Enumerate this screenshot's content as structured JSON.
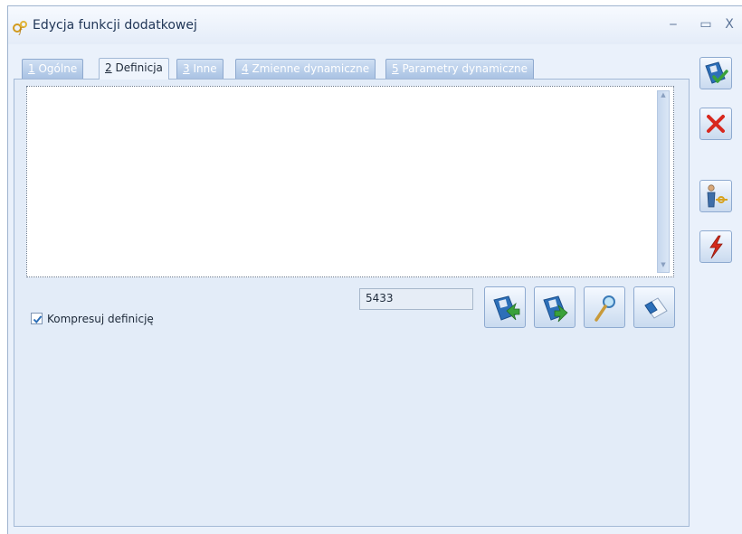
{
  "window": {
    "title": "Edycja funkcji dodatkowej",
    "minimize_glyph": "‒",
    "maximize_glyph": "▭",
    "close_glyph": "X"
  },
  "tabs": [
    {
      "num": "1",
      "label": "Ogólne",
      "active": false
    },
    {
      "num": "2",
      "label": "Definicja",
      "active": true
    },
    {
      "num": "3",
      "label": "Inne",
      "active": false
    },
    {
      "num": "4",
      "label": "Zmienne dynamiczne",
      "active": false
    },
    {
      "num": "5",
      "label": "Parametry dynamiczne",
      "active": false
    }
  ],
  "definition": {
    "text": "",
    "size_value": "5433",
    "compress_label": "Kompresuj definicję",
    "compress_checked": true
  },
  "icons": {
    "app": "function-gear-icon",
    "save": "floppy-check-icon",
    "cancel": "red-x-icon",
    "user_key": "user-key-icon",
    "lightning": "lightning-icon",
    "import": "floppy-import-icon",
    "export": "floppy-export-icon",
    "preview": "magnifier-icon",
    "clear": "eraser-icon"
  },
  "colors": {
    "accent_blue": "#2d6fb8",
    "check_green": "#3aa13a",
    "cancel_red": "#d8281e",
    "lightning_red": "#d42a1a"
  }
}
